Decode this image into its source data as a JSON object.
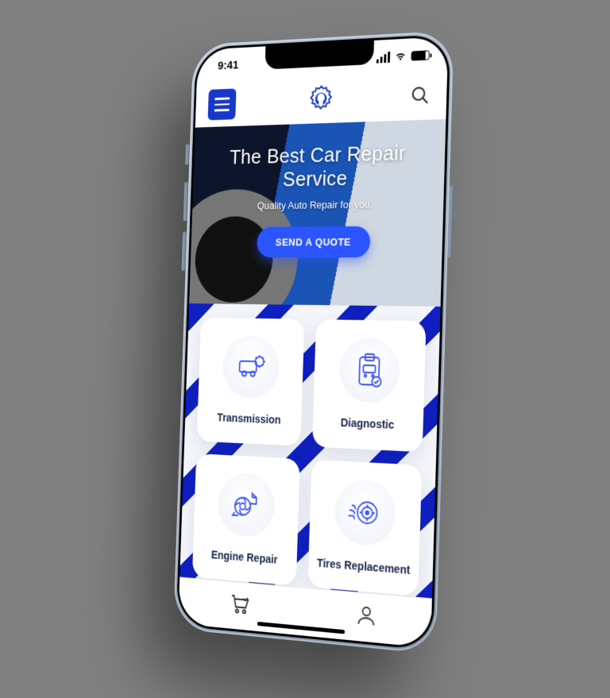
{
  "status": {
    "time": "9:41"
  },
  "hero": {
    "title": "The Best Car Repair Service",
    "subtitle": "Quality Auto Repair for you.",
    "cta": "SEND A QUOTE"
  },
  "services": [
    {
      "label": "Transmission",
      "icon": "car-gear-icon"
    },
    {
      "label": "Diagnostic",
      "icon": "clipboard-check-icon"
    },
    {
      "label": "Engine Repair",
      "icon": "turbo-icon"
    },
    {
      "label": "Tires Replacement",
      "icon": "tire-icon"
    }
  ],
  "tabs": [
    {
      "name": "cart",
      "icon": "cart-icon"
    },
    {
      "name": "profile",
      "icon": "profile-icon"
    }
  ],
  "colors": {
    "primary": "#1838c9",
    "accent": "#2a55ff"
  }
}
